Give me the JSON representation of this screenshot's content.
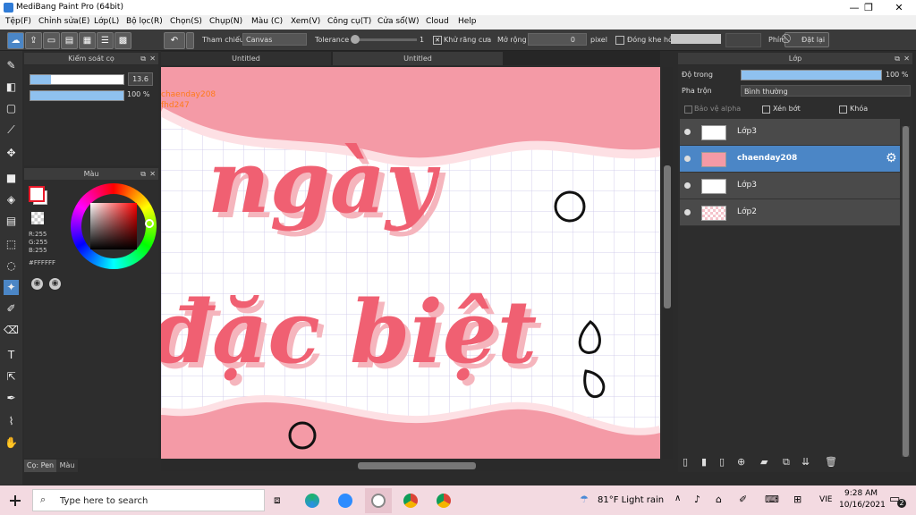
{
  "window": {
    "title": "MediBang Paint Pro (64bit)",
    "controls": {
      "minimize": "—",
      "maximize": "❐",
      "close": "✕"
    }
  },
  "menu": [
    "Tệp(F)",
    "Chỉnh sửa(E)",
    "Lớp(L)",
    "Bộ lọc(R)",
    "Chọn(S)",
    "Chụp(N)",
    "Màu (C)",
    "Xem(V)",
    "Công cụ(T)",
    "Cửa sổ(W)",
    "Cloud",
    "Help"
  ],
  "toolbar": {
    "reference_label": "Tham chiếu",
    "reference_value": "Canvas",
    "tolerance_label": "Tolerance",
    "tolerance_value": "1",
    "antialias_label": "Khử răng cưa",
    "expand_label": "Mở rộng",
    "expand_value": "0",
    "expand_unit": "pixel",
    "gap_close_label": "Đóng khe hở",
    "key_label": "Phím",
    "reset_label": "Đặt lại"
  },
  "brush_panel": {
    "title": "Kiểm soát cọ",
    "size_value": "13.6",
    "opacity_value": "100 %",
    "size_fraction": 0.22,
    "opacity_fraction": 1.0
  },
  "color_panel": {
    "title": "Màu",
    "r": "R:255",
    "g": "G:255",
    "b": "B:255",
    "hex": "#FFFFFF",
    "fg_color": "#ffffff",
    "bg_color": "#e81828"
  },
  "bottom_tabs": [
    "Cọ: Pen",
    "Màu"
  ],
  "canvas": {
    "tabs": [
      "Untitled",
      "Untitled"
    ],
    "watermark_1": "chaenday208",
    "watermark_2": "fhd247",
    "text_line_1": "ngày",
    "text_line_2": "đặc biệt",
    "accent": "#f06072",
    "band": "#f49aa6"
  },
  "layer_panel": {
    "title": "Lớp",
    "opacity_label": "Độ trong",
    "opacity_value": "100 %",
    "blend_label": "Pha trộn",
    "blend_value": "Bình thường",
    "protect_alpha": "Bảo vệ alpha",
    "clipping": "Xén bớt",
    "lock": "Khóa",
    "layers": [
      {
        "name": "Lớp3",
        "selected": false
      },
      {
        "name": "chaenday208",
        "selected": true
      },
      {
        "name": "Lớp3",
        "selected": false
      },
      {
        "name": "Lớp2",
        "selected": false
      }
    ]
  },
  "taskbar": {
    "search_placeholder": "Type here to search",
    "weather": "81°F  Light rain",
    "lang": "VIE",
    "time": "9:28 AM",
    "date": "10/16/2021",
    "notif_count": "2"
  },
  "icons": [
    "windows-icon",
    "search-icon",
    "task-view-icon",
    "edge-icon",
    "zoom-icon",
    "medibang-icon",
    "chrome-icon",
    "chrome-icon"
  ]
}
